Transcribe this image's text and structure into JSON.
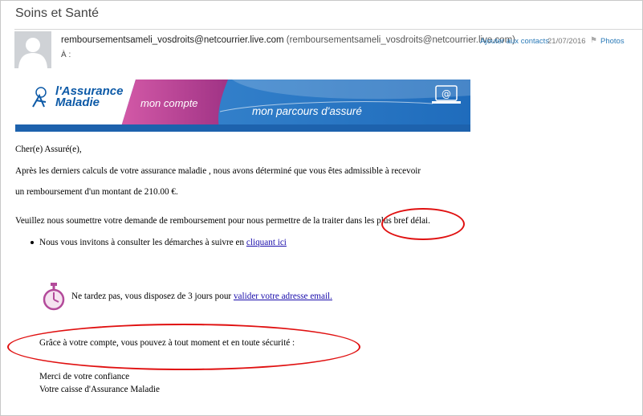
{
  "email": {
    "subject": "Soins et Santé",
    "sender_name": "remboursementsameli_vosdroits@netcourrier.live.com",
    "sender_address": "(remboursementsameli_vosdroits@netcourrier.live.com)",
    "add_contact_label": "Ajouter aux contacts",
    "date": "21/07/2016",
    "photos_label": "Photos",
    "to_label": "À :"
  },
  "banner": {
    "logo_line1": "l'Assurance",
    "logo_line2": "Maladie",
    "tab_left": "mon compte",
    "tab_right": "mon parcours d'assuré"
  },
  "body": {
    "greeting": "Cher(e) Assuré(e),",
    "para1_line1": "Après les derniers calculs de votre assurance maladie , nous avons déterminé que vous êtes admissible à recevoir",
    "para1_line2": "un remboursement d'un montant de 210.00 €.",
    "para2": "Veuillez nous soumettre votre demande de remboursement pour nous permettre de la traiter dans les plus bref délai.",
    "bullet_text": "Nous vous invitons à consulter les démarches à suivre en ",
    "bullet_link": "cliquant ici",
    "deadline_text": "Ne tardez pas, vous disposez de 3 jours pour ",
    "deadline_link": "valider votre adresse email.",
    "security_text": "Grâce à votre compte, vous pouvez à tout moment et en toute sécurité :",
    "closing1": "Merci de votre confiance",
    "closing2": "Votre caisse d'Assurance Maladie"
  },
  "colors": {
    "annotation_red": "#e01010",
    "link_blue": "#1a0dab",
    "brand_blue": "#0d5aa7",
    "brand_pink": "#c0479a"
  },
  "icons": [
    "avatar-icon",
    "flag-icon",
    "stopwatch-icon",
    "laptop-email-icon",
    "assurance-maladie-logo"
  ]
}
